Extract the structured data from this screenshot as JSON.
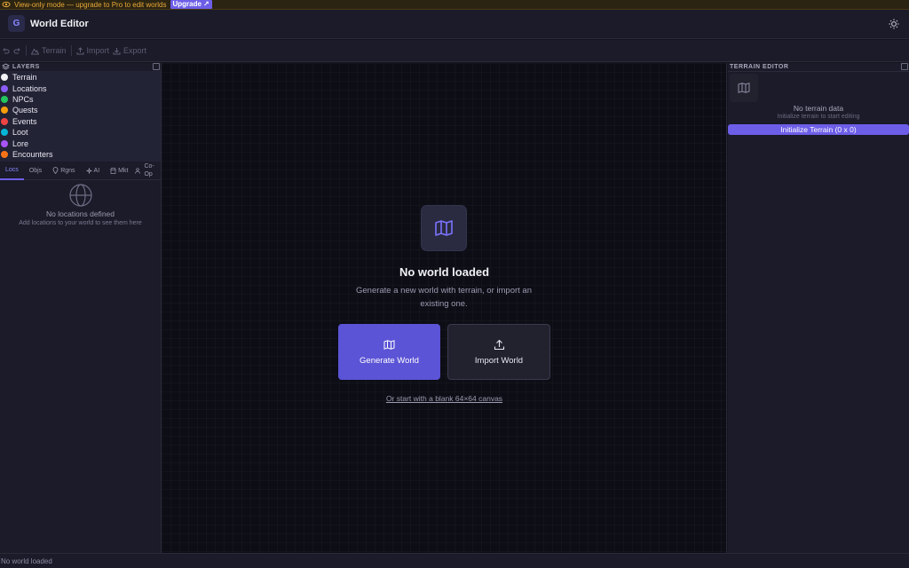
{
  "banner": {
    "text": "View-only mode — upgrade to Pro to edit worlds",
    "upgrade_label": "Upgrade",
    "upgrade_arrow": "↗",
    "icon": "eye-icon",
    "color": "#e8a93a"
  },
  "header": {
    "logo_letter": "G",
    "title": "World Editor",
    "theme_icon": "sun-icon"
  },
  "toolbar": {
    "undo_icon": "undo-icon",
    "redo_icon": "redo-icon",
    "terrain_label": "Terrain",
    "import_label": "Import",
    "export_label": "Export"
  },
  "layers": {
    "header": "LAYERS",
    "items": [
      {
        "label": "Terrain",
        "color": "#f2f2f7"
      },
      {
        "label": "Locations",
        "color": "#8b5cf6"
      },
      {
        "label": "NPCs",
        "color": "#22c55e"
      },
      {
        "label": "Quests",
        "color": "#f59e0b"
      },
      {
        "label": "Events",
        "color": "#ef4444"
      },
      {
        "label": "Loot",
        "color": "#06b6d4"
      },
      {
        "label": "Lore",
        "color": "#a855f7"
      },
      {
        "label": "Encounters",
        "color": "#f97316"
      }
    ]
  },
  "tabs": {
    "items": [
      {
        "label": "Locs",
        "active": true
      },
      {
        "label": "Objs"
      },
      {
        "label": "Rgns"
      },
      {
        "label": "AI"
      },
      {
        "label": "Mkt"
      },
      {
        "label": "Co-Op"
      }
    ]
  },
  "locations": {
    "empty_title": "No locations defined",
    "empty_sub": "Add locations to your world to see them here"
  },
  "canvas": {
    "title": "No world loaded",
    "subtitle": "Generate a new world with terrain, or import an existing one.",
    "generate_label": "Generate World",
    "import_label": "Import World",
    "blank_link": "Or start with a blank 64×64 canvas",
    "accent": "#5b54d6"
  },
  "terrain_editor": {
    "header": "TERRAIN EDITOR",
    "empty_title": "No terrain data",
    "empty_sub": "Initialize terrain to start editing",
    "init_label": "Initialize Terrain (0 x 0)"
  },
  "status": {
    "text": "No world loaded"
  }
}
